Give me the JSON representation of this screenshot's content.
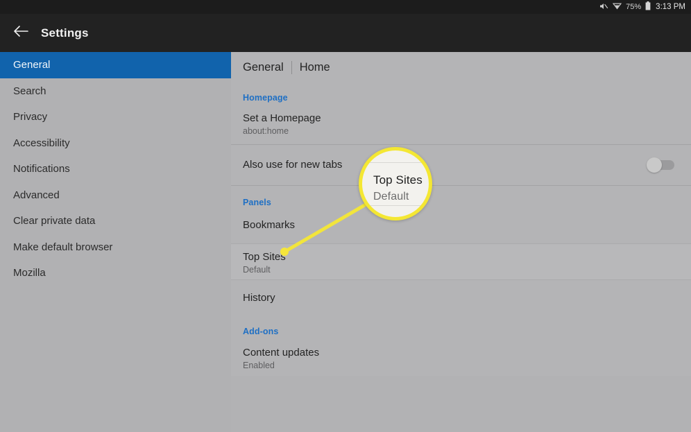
{
  "status_bar": {
    "mute_icon": "mute-icon",
    "wifi_icon": "wifi-icon",
    "battery_percent": "75%",
    "battery_icon": "battery-icon",
    "time": "3:13 PM"
  },
  "app_bar": {
    "back_icon": "back-arrow-icon",
    "title": "Settings"
  },
  "sidebar": {
    "items": [
      {
        "label": "General",
        "selected": true
      },
      {
        "label": "Search",
        "selected": false
      },
      {
        "label": "Privacy",
        "selected": false
      },
      {
        "label": "Accessibility",
        "selected": false
      },
      {
        "label": "Notifications",
        "selected": false
      },
      {
        "label": "Advanced",
        "selected": false
      },
      {
        "label": "Clear private data",
        "selected": false
      },
      {
        "label": "Make default browser",
        "selected": false
      },
      {
        "label": "Mozilla",
        "selected": false
      }
    ]
  },
  "main": {
    "breadcrumb": {
      "parent": "General",
      "current": "Home"
    },
    "sections": {
      "homepage": {
        "heading": "Homepage",
        "set_homepage": {
          "title": "Set a Homepage",
          "subtitle": "about:home"
        },
        "new_tabs": {
          "title": "Also use for new tabs",
          "toggle_state": "off"
        }
      },
      "panels": {
        "heading": "Panels",
        "bookmarks": {
          "title": "Bookmarks"
        },
        "top_sites": {
          "title": "Top Sites",
          "subtitle": "Default"
        },
        "history": {
          "title": "History"
        }
      },
      "addons": {
        "heading": "Add-ons",
        "content_updates": {
          "title": "Content updates",
          "subtitle": "Enabled"
        }
      }
    }
  },
  "callout": {
    "title": "Top Sites",
    "subtitle": "Default",
    "ring_color": "#f4e733",
    "pointer_color": "#f2e53b"
  }
}
